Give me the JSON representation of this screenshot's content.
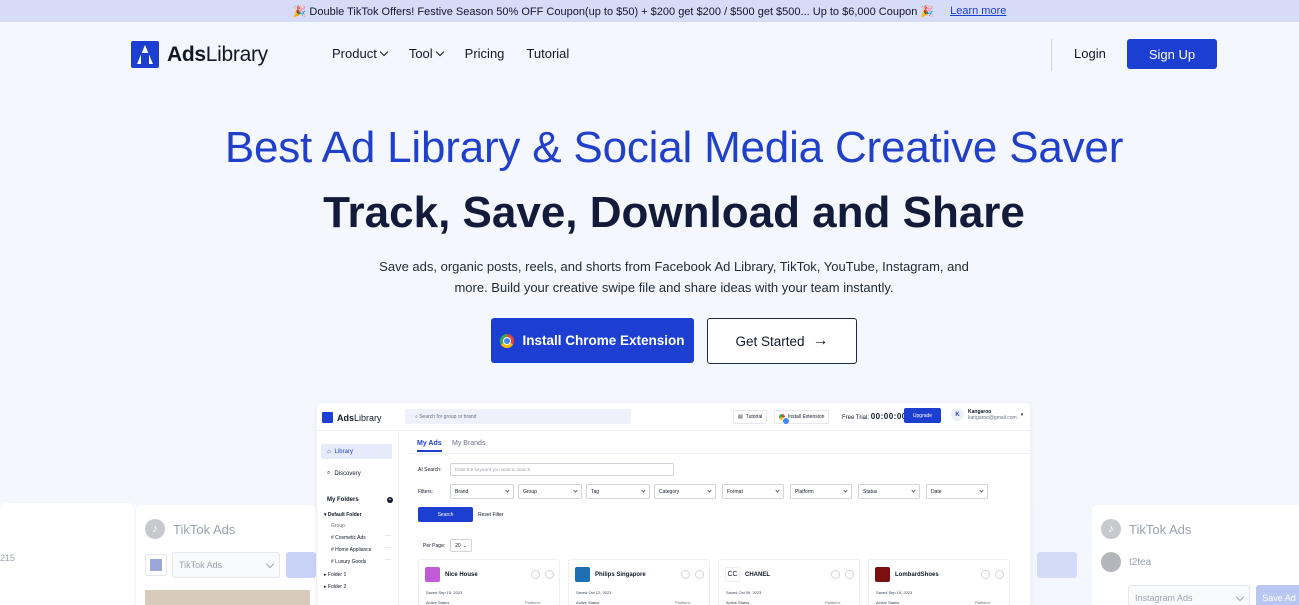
{
  "banner": {
    "text": "🎉 Double TikTok Offers! Festive Season 50% OFF Coupon(up to $50) + $200 get $200 / $500 get $500... Up to $6,000 Coupon 🎉",
    "link": "Learn more"
  },
  "nav": {
    "brand_bold": "Ads",
    "brand_rest": "Library",
    "items": [
      {
        "label": "Product",
        "dropdown": true
      },
      {
        "label": "Tool",
        "dropdown": true
      },
      {
        "label": "Pricing",
        "dropdown": false
      },
      {
        "label": "Tutorial",
        "dropdown": false
      }
    ],
    "login": "Login",
    "signup": "Sign Up"
  },
  "hero": {
    "title": "Best Ad Library & Social Media Creative Saver",
    "subtitle": "Track, Save, Download and Share",
    "description": "Save ads, organic posts, reels, and shorts from Facebook Ad Library, TikTok, YouTube, Instagram, and more. Build your creative swipe file and share ideas with your team instantly.",
    "cta_primary": "Install Chrome Extension",
    "cta_secondary": "Get Started"
  },
  "side_left": {
    "number": "215",
    "tiktok_label": "TikTok Ads",
    "select_value": "TikTok Ads"
  },
  "side_right": {
    "tiktok_label": "TikTok Ads",
    "account": "t2tea",
    "select_value": "Instagram Ads",
    "save_button": "Save Ad"
  },
  "app": {
    "brand_bold": "Ads",
    "brand_rest": "Library",
    "search_placeholder": "Search for group or brand",
    "tutorial": "Tutorial",
    "install": "Install Extension",
    "trial_label": "Free Trial:",
    "trial_time": "00:00:00",
    "upgrade": "Upgrade",
    "user_initial": "K",
    "user_name": "Kangaroo",
    "user_email": "kangaroo@gmail.com",
    "sidebar": {
      "library": "Library",
      "discovery": "Discovery",
      "folders_title": "My Folders",
      "default_folder": "Default Folder",
      "group": "Group",
      "subfolders": [
        "# Cosmetic Ads",
        "# Home Appliance",
        "# Luxury Goods"
      ],
      "folder1": "Folder 1",
      "folder2": "Folder 2"
    },
    "tabs": [
      "My Ads",
      "My Brands"
    ],
    "ai_search_label": "AI Search:",
    "ai_search_placeholder": "Enter the keyword you want to search",
    "filters_label": "Filters:",
    "filters": [
      "Brand",
      "Group",
      "Tag",
      "Category",
      "Format",
      "Platform",
      "Status",
      "Date"
    ],
    "search_button": "Search",
    "reset": "Reset Filter",
    "per_page_label": "Per Page:",
    "per_page_value": "20",
    "cards": [
      {
        "name": "Nice House",
        "saved": "Saved Sep 15, 2023",
        "status": "Active Status",
        "platform": "Platform:",
        "color": "#c35bd8"
      },
      {
        "name": "Philips Singapore",
        "saved": "Saved Oct 12, 2023",
        "status": "Active Status",
        "platform": "Platform:",
        "color": "#1f6fb5"
      },
      {
        "name": "CHANEL",
        "saved": "Saved Oct 09, 2023",
        "status": "Active Status",
        "platform": "Platform:",
        "color": "#ffffff"
      },
      {
        "name": "LombardShoes",
        "saved": "Saved Sep 15, 2023",
        "status": "Active Status",
        "platform": "Platform:",
        "color": "#7a1010"
      }
    ]
  }
}
